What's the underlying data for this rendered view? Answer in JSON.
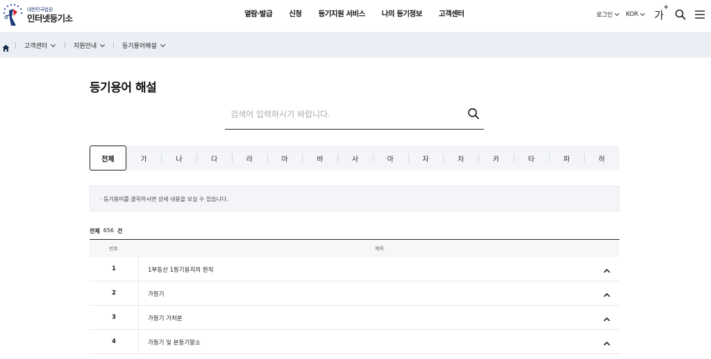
{
  "header": {
    "logo_sub": "대한민국법원",
    "logo_main": "인터넷등기소",
    "nav": [
      "열람·발급",
      "신청",
      "등기지원 서비스",
      "나의 등기정보",
      "고객센터"
    ],
    "login": "로그인",
    "language": "KOR",
    "font_size": "가",
    "font_size_plus": "+"
  },
  "breadcrumb": [
    "고객센터",
    "지원안내",
    "등기용어해설"
  ],
  "page": {
    "title": "등기용어 해설",
    "search_placeholder": "검색어 입력하시기 바랍니다."
  },
  "tabs": [
    "전체",
    "가",
    "나",
    "다",
    "라",
    "마",
    "바",
    "사",
    "아",
    "자",
    "차",
    "카",
    "타",
    "파",
    "하"
  ],
  "notice": "· 등기용어를 클릭하시면 상세 내용을 보실 수 있습니다.",
  "count": {
    "label": "전체",
    "value": "656",
    "unit": "건"
  },
  "table": {
    "headers": [
      "번호",
      "제목"
    ],
    "rows": [
      {
        "no": "1",
        "title": "1부동산 1등기용지의 원칙"
      },
      {
        "no": "2",
        "title": "가등기"
      },
      {
        "no": "3",
        "title": "가등기 가처분"
      },
      {
        "no": "4",
        "title": "가등기 및 본등기말소"
      }
    ]
  },
  "colors": {
    "accent_navy": "#1e3a7a",
    "breadcrumb_bg": "#eceef5",
    "tab_bg": "#f4f5f8"
  }
}
